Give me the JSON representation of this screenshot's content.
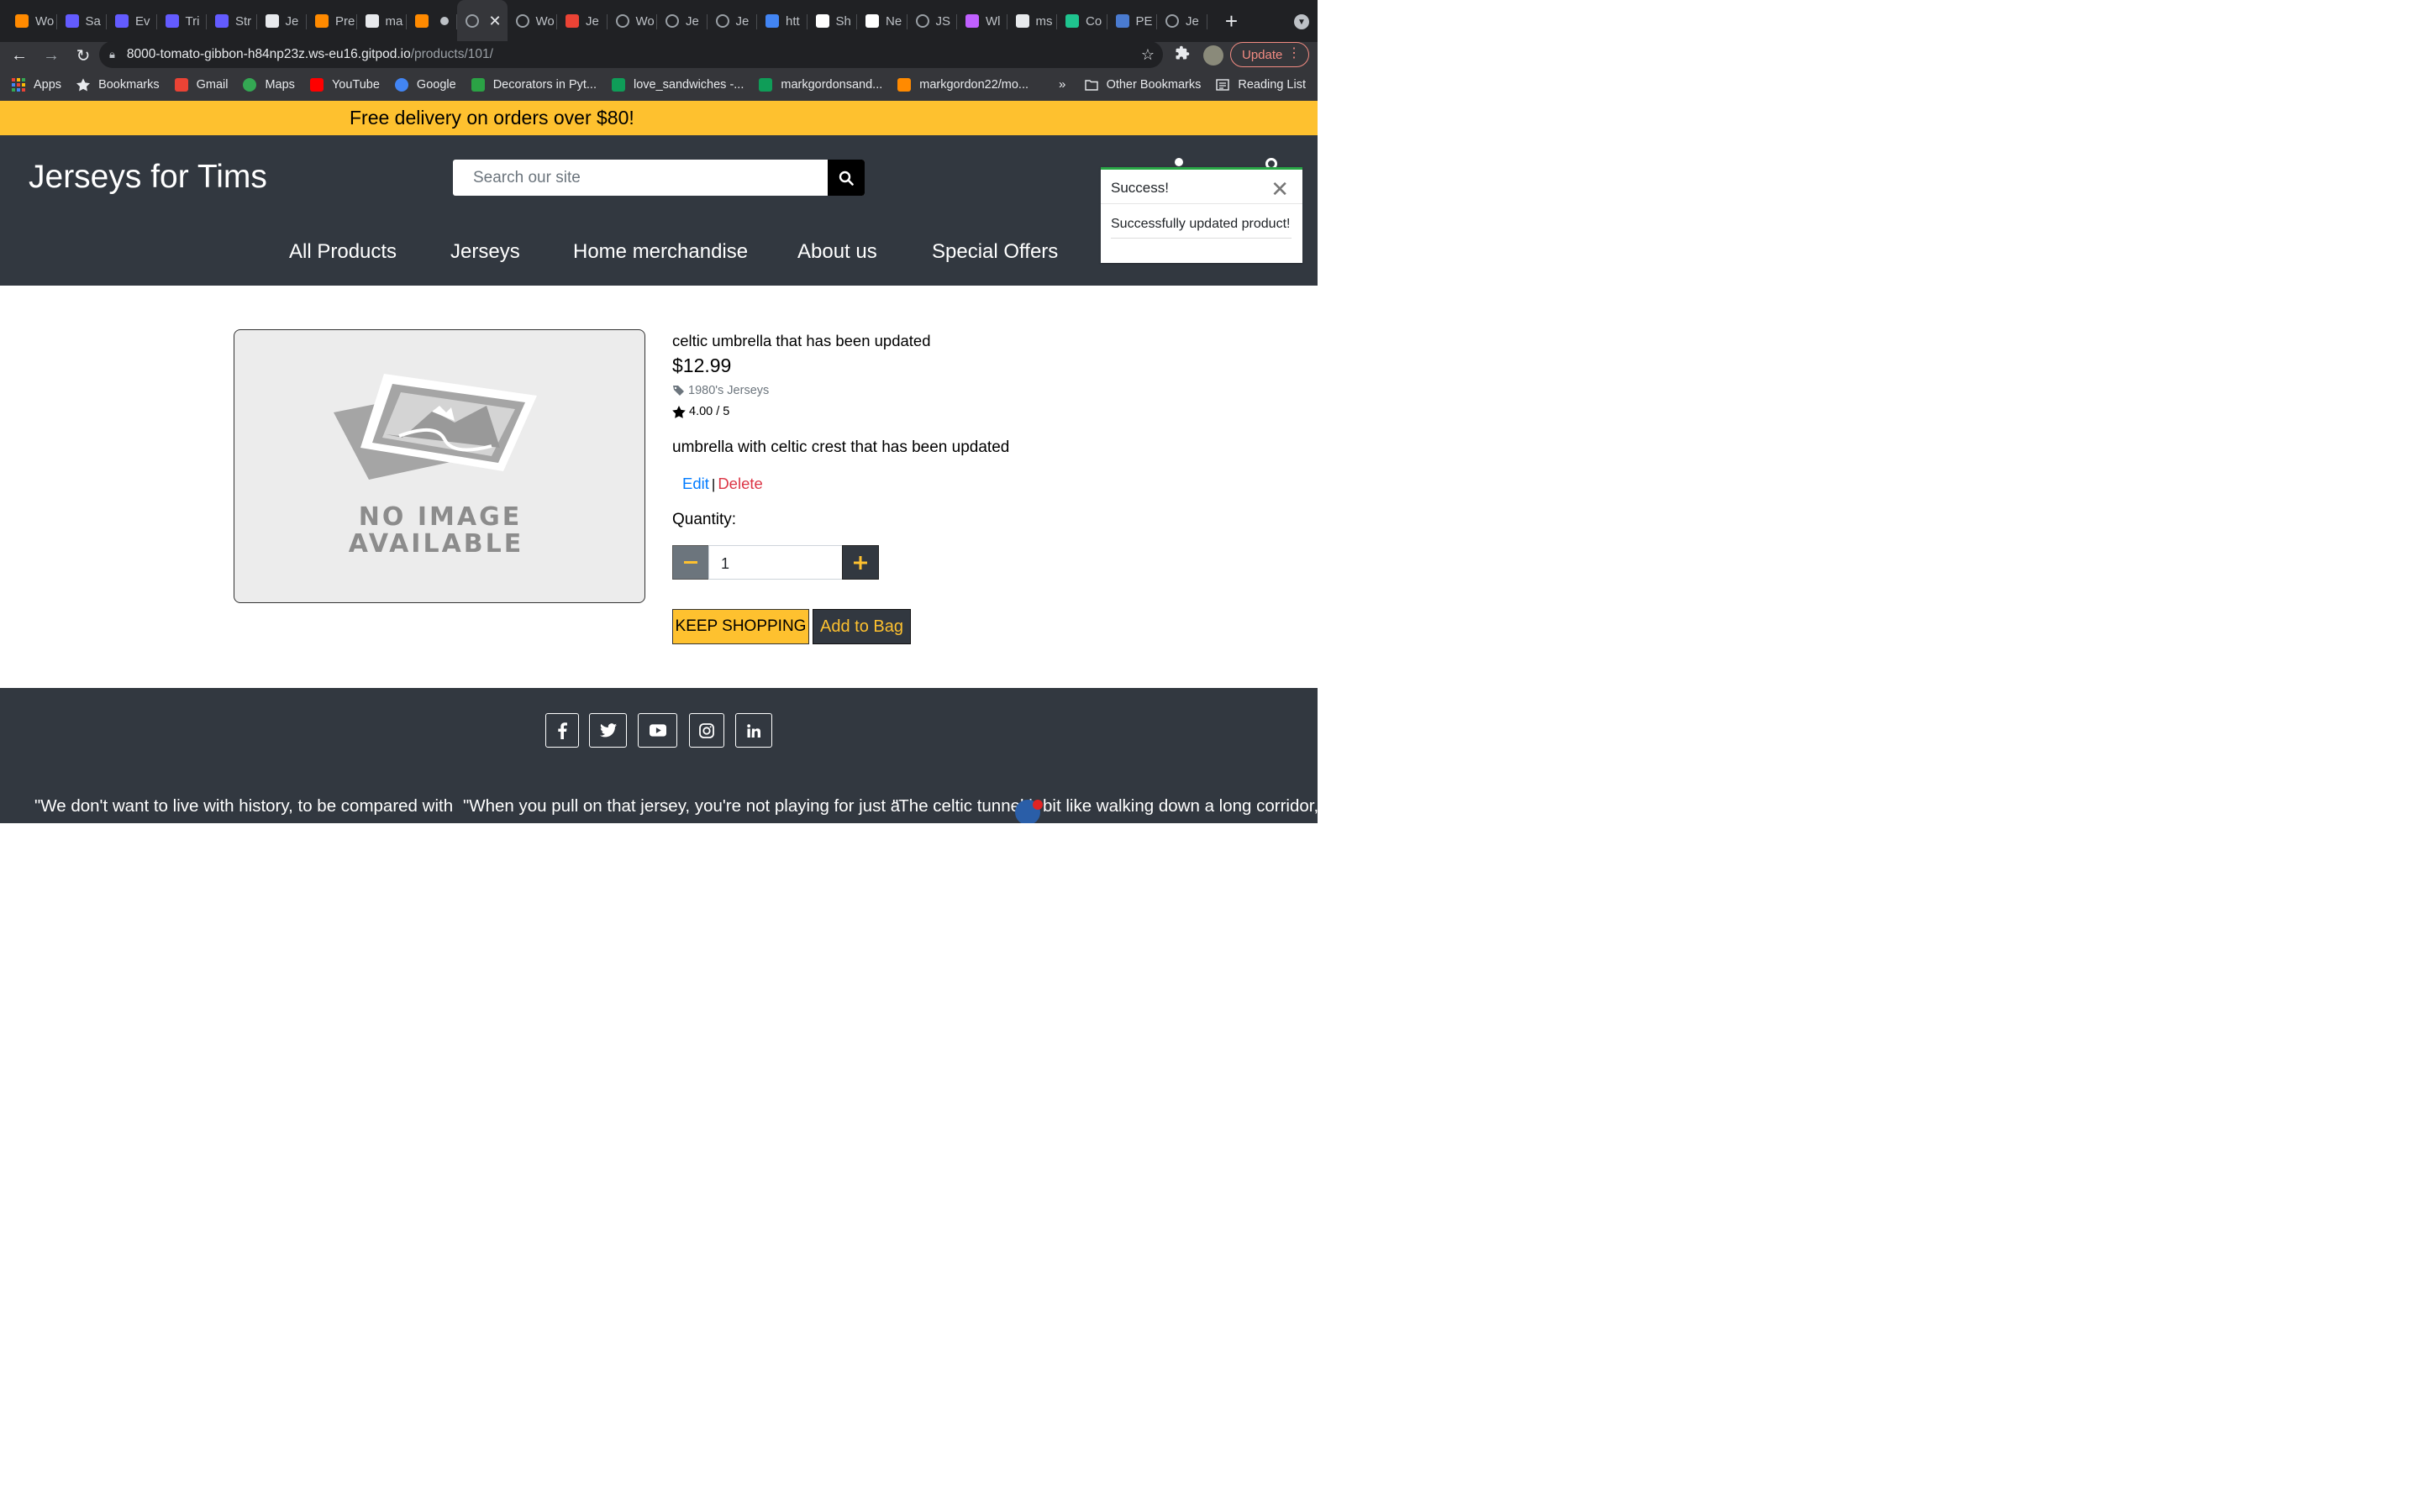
{
  "browser": {
    "tabs": [
      {
        "label": "Wo",
        "icon": "gitpod-icon",
        "color": "#ff8a00"
      },
      {
        "label": "Sa",
        "icon": "stripe-icon",
        "color": "#635bff"
      },
      {
        "label": "Ev",
        "icon": "stripe-icon",
        "color": "#635bff"
      },
      {
        "label": "Tri",
        "icon": "stripe-icon",
        "color": "#635bff"
      },
      {
        "label": "Str",
        "icon": "stripe-icon",
        "color": "#635bff"
      },
      {
        "label": "Je",
        "icon": "github-icon",
        "color": "#e8eaed"
      },
      {
        "label": "Pre",
        "icon": "gitpod-icon",
        "color": "#ff8a00"
      },
      {
        "label": "ma",
        "icon": "github-icon",
        "color": "#e8eaed"
      },
      {
        "label": "",
        "icon": "gitpod-icon",
        "color": "#ff8a00"
      },
      {
        "label": "",
        "icon": "globe-icon",
        "color": "#9aa0a6",
        "active": true
      },
      {
        "label": "Wo",
        "icon": "globe-icon",
        "color": "#9aa0a6"
      },
      {
        "label": "Je",
        "icon": "gmail-icon",
        "color": "#ea4335"
      },
      {
        "label": "Wo",
        "icon": "globe-icon",
        "color": "#9aa0a6"
      },
      {
        "label": "Je",
        "icon": "globe-icon",
        "color": "#9aa0a6"
      },
      {
        "label": "Je",
        "icon": "globe-icon",
        "color": "#9aa0a6"
      },
      {
        "label": "htt",
        "icon": "google-icon",
        "color": "#4285f4"
      },
      {
        "label": "Sh",
        "icon": "nu-icon",
        "color": "#ffffff"
      },
      {
        "label": "Ne",
        "icon": "smiley-icon",
        "color": "#ffffff"
      },
      {
        "label": "JS",
        "icon": "globe-icon",
        "color": "#9aa0a6"
      },
      {
        "label": "Wl",
        "icon": "colorful-icon",
        "color": "#c060ff"
      },
      {
        "label": "ms",
        "icon": "github-icon",
        "color": "#e8eaed"
      },
      {
        "label": "Co",
        "icon": "green-doc-icon",
        "color": "#1fc48f"
      },
      {
        "label": "PE",
        "icon": "pep8-icon",
        "color": "#4a7bd0"
      },
      {
        "label": "Je",
        "icon": "globe-icon",
        "color": "#9aa0a6"
      }
    ],
    "url_host": "8000-tomato-gibbon-h84np23z.ws-eu16.gitpod.io",
    "url_path": "/products/101/",
    "update_label": "Update",
    "bookmarks": [
      {
        "label": "Apps",
        "icon": "apps-grid-icon",
        "color": "#ea4335"
      },
      {
        "label": "Bookmarks",
        "icon": "star-icon",
        "color": "#e8eaed"
      },
      {
        "label": "Gmail",
        "icon": "gmail-icon",
        "color": "#ea4335"
      },
      {
        "label": "Maps",
        "icon": "maps-pin-icon",
        "color": "#34a853"
      },
      {
        "label": "YouTube",
        "icon": "youtube-icon",
        "color": "#ff0000"
      },
      {
        "label": "Google",
        "icon": "google-icon",
        "color": "#4285f4"
      },
      {
        "label": "Decorators in Pyt...",
        "icon": "realpython-icon",
        "color": "#2ba245"
      },
      {
        "label": "love_sandwiches -...",
        "icon": "sheets-icon",
        "color": "#0f9d58"
      },
      {
        "label": "markgordonsand...",
        "icon": "sheets-icon",
        "color": "#0f9d58"
      },
      {
        "label": "markgordon22/mo...",
        "icon": "gitpod-icon",
        "color": "#ff8a00"
      }
    ],
    "overflow_label": "»",
    "other_bookmarks": "Other Bookmarks",
    "reading_list": "Reading List"
  },
  "site": {
    "banner": "Free delivery on orders over $80!",
    "brand": "Jerseys for Tims",
    "search_placeholder": "Search our site",
    "nav": [
      "All Products",
      "Jerseys",
      "Home merchandise",
      "About us",
      "Special Offers"
    ],
    "accent": "#fec12f",
    "dark": "#323840"
  },
  "toast": {
    "title": "Success!",
    "message": "Successfully updated product!"
  },
  "product": {
    "image_text_1": "NO IMAGE",
    "image_text_2": "AVAILABLE",
    "name": "celtic umbrella that has been updated",
    "price": "$12.99",
    "category": "1980's Jerseys",
    "rating": "4.00 / 5",
    "description": "umbrella with celtic crest that has been updated",
    "edit_label": "Edit",
    "separator": "|",
    "delete_label": "Delete",
    "quantity_label": "Quantity:",
    "quantity_value": "1",
    "keep_shopping": "KEEP SHOPPING",
    "add_to_bag": "Add to Bag"
  },
  "footer": {
    "social": [
      "facebook-icon",
      "twitter-icon",
      "youtube-icon",
      "instagram-icon",
      "linkedin-icon"
    ],
    "quotes": [
      "\"We don't want to live with history, to be compared with",
      "\"When you pull on that jersey, you're not playing for just a",
      "\"The celtic tunnel i",
      "bit like walking down a long corridor,"
    ]
  }
}
